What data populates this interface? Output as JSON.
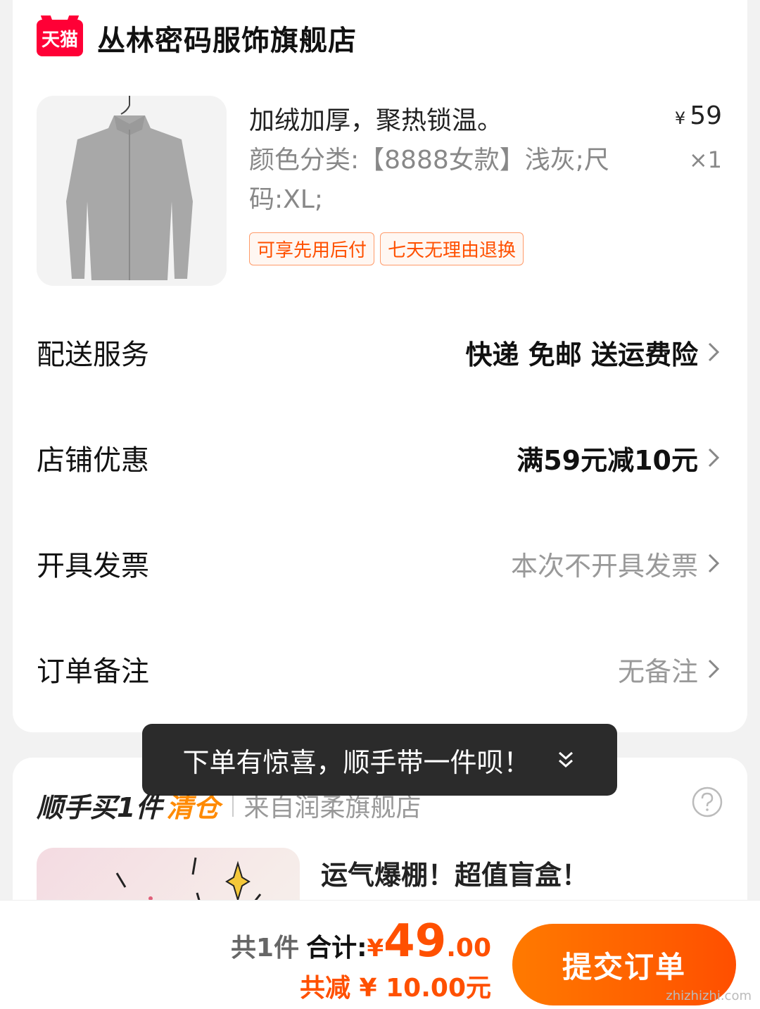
{
  "shop": {
    "badge": "天猫",
    "name": "丛林密码服饰旗舰店"
  },
  "product": {
    "image_icon": "fleece-jacket-icon",
    "title": "加绒加厚，聚热锁温。",
    "price_symbol": "¥",
    "price": "59",
    "spec": "颜色分类:【8888女款】浅灰;尺码:XL;",
    "quantity": "×1",
    "tags": [
      "可享先用后付",
      "七天无理由退换"
    ]
  },
  "rows": {
    "delivery": {
      "label": "配送服务",
      "value": "快递 免邮 送运费险"
    },
    "coupon": {
      "label": "店铺优惠",
      "value": "满59元减10元"
    },
    "invoice": {
      "label": "开具发票",
      "value": "本次不开具发票"
    },
    "note": {
      "label": "订单备注",
      "value": "无备注"
    }
  },
  "addon": {
    "title": "顺手买1件",
    "accent": "清仓",
    "source": "来自润柔旗舰店",
    "promo_title": "运气爆棚！超值盲盒！"
  },
  "toast": {
    "text": "下单有惊喜，顺手带一件呗！"
  },
  "footer": {
    "count": "共1件",
    "sum_label": "合计:",
    "sum_symbol": "¥",
    "sum_int": "49",
    "sum_dec": ".00",
    "discount": "共减 ¥ 10.00元",
    "submit": "提交订单",
    "watermark": "zhizhizhi.com"
  },
  "colors": {
    "accent": "#ff5000",
    "tmall": "#ff0036",
    "toast_bg": "#1e1e1e"
  }
}
